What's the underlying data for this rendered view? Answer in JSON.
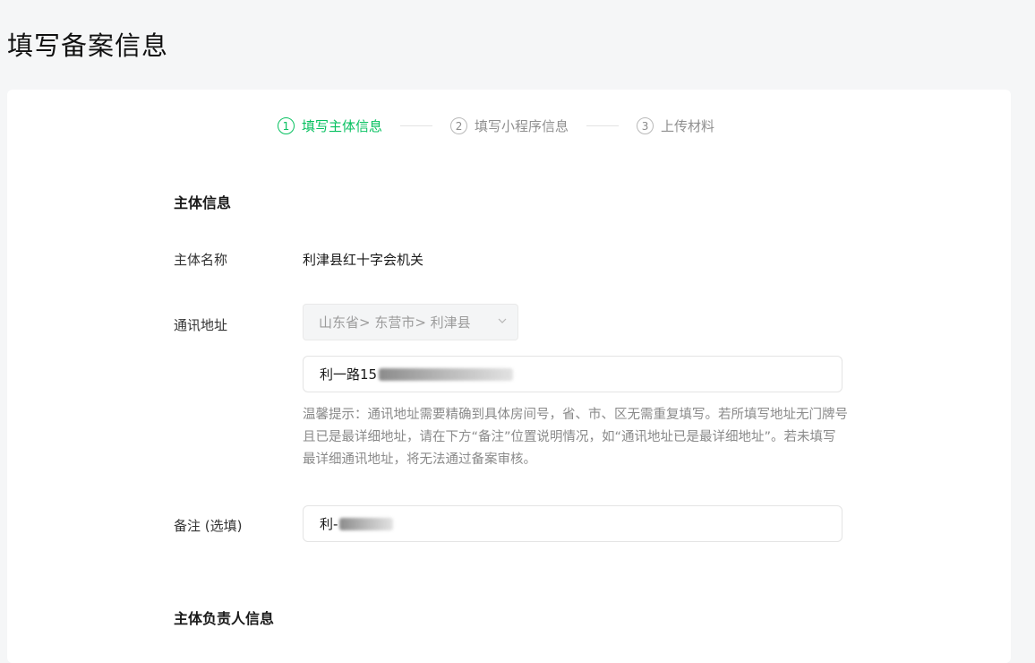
{
  "page": {
    "title": "填写备案信息"
  },
  "steps": [
    {
      "num": "1",
      "label": "填写主体信息",
      "active": true
    },
    {
      "num": "2",
      "label": "填写小程序信息",
      "active": false
    },
    {
      "num": "3",
      "label": "上传材料",
      "active": false
    }
  ],
  "subject_section": {
    "title": "主体信息",
    "name_label": "主体名称",
    "name_value": "利津县红十字会机关",
    "address_label": "通讯地址",
    "region_select": "山东省> 东营市> 利津县",
    "address_input_value": "利一路15",
    "hint": "温馨提示：通讯地址需要精确到具体房间号，省、市、区无需重复填写。若所填写地址无门牌号且已是最详细地址，请在下方“备注”位置说明情况，如“通讯地址已是最详细地址”。若未填写最详细通讯地址，将无法通过备案审核。",
    "remark_label": "备注 (选填)",
    "remark_input_value": "利-"
  },
  "responsible_section": {
    "title": "主体负责人信息"
  },
  "icons": {
    "select_arrow": "chevron-down-icon"
  },
  "colors": {
    "accent": "#07c160",
    "inactive": "#8f8f8f"
  }
}
